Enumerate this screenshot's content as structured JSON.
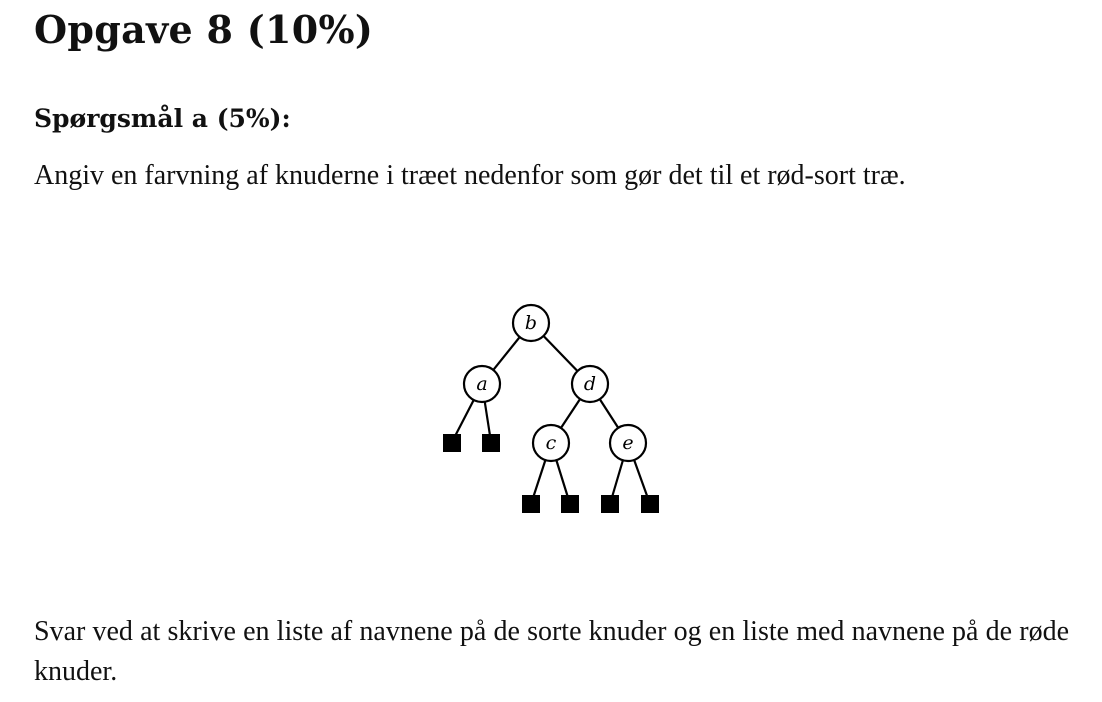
{
  "heading": {
    "title": "Opgave 8 (10%)"
  },
  "question_a": {
    "title": "Spørgsmål a (5%):",
    "prompt": "Angiv en farvning af knuderne i træet nedenfor som gør det til et rød-sort træ.",
    "answer_instructions": "Svar ved at skrive en liste af navnene på de sorte knuder og en liste med navnene på de røde knuder."
  },
  "tree": {
    "nodes": [
      {
        "id": "b",
        "label": "b",
        "children": [
          "a",
          "d"
        ]
      },
      {
        "id": "a",
        "label": "a",
        "children": [
          "leaf",
          "leaf"
        ]
      },
      {
        "id": "d",
        "label": "d",
        "children": [
          "c",
          "e"
        ]
      },
      {
        "id": "c",
        "label": "c",
        "children": [
          "leaf",
          "leaf"
        ]
      },
      {
        "id": "e",
        "label": "e",
        "children": [
          "leaf",
          "leaf"
        ]
      }
    ],
    "leaf_type": "nil-leaf"
  }
}
